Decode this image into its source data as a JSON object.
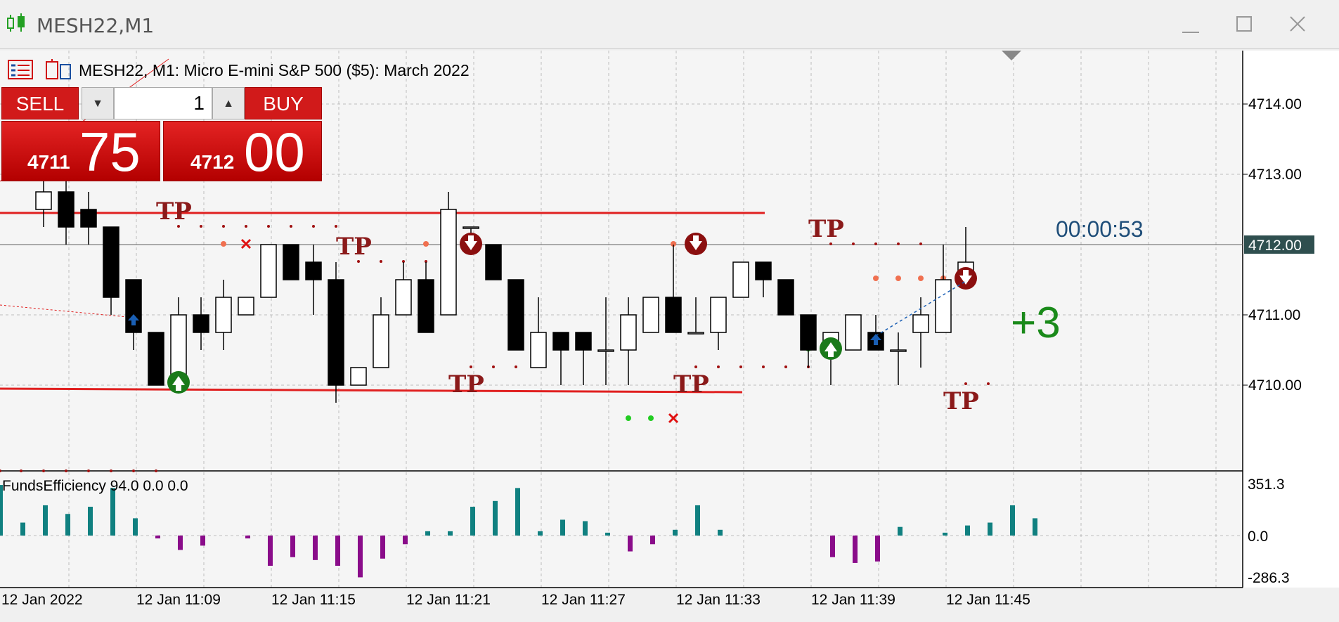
{
  "window": {
    "title": "MESH22,M1",
    "minimize_label": "minimize",
    "maximize_label": "maximize",
    "close_label": "close"
  },
  "chart": {
    "header_text": "MESH22, M1:  Micro E-mini S&P 500 ($5): March 2022",
    "timer": "00:00:53",
    "position_label": "+3",
    "current_price_label": "4712.00",
    "price_ticks": [
      "4714.00",
      "4713.00",
      "4711.00",
      "4710.00"
    ],
    "time_ticks": [
      "12 Jan 2022",
      "12 Jan 11:09",
      "12 Jan 11:15",
      "12 Jan 11:21",
      "12 Jan 11:27",
      "12 Jan 11:33",
      "12 Jan 11:39",
      "12 Jan 11:45"
    ],
    "tp_label": "TP",
    "colors": {
      "bull_fill": "#ffffff",
      "bear_fill": "#000000",
      "level_line": "#e02020",
      "tp_text": "#8b1a1a",
      "position_green": "#1a8a1a",
      "timer_blue": "#1f4e79",
      "hist_pos": "#108080",
      "hist_neg": "#8a0c8a"
    }
  },
  "indicator": {
    "label": "FundsEfficiency 94.0 0.0 0.0",
    "scale_top": "351.3",
    "scale_mid": "0.0",
    "scale_bottom": "-286.3"
  },
  "trade_panel": {
    "sell_label": "SELL",
    "buy_label": "BUY",
    "quantity": "1",
    "bid_small": "4711",
    "bid_big": "75",
    "ask_small": "4712",
    "ask_big": "00"
  },
  "chart_data": {
    "type": "candlestick",
    "candles": [
      {
        "o": 4712.5,
        "h": 4713.0,
        "l": 4712.25,
        "c": 4712.75
      },
      {
        "o": 4712.75,
        "h": 4713.0,
        "l": 4712.0,
        "c": 4712.25
      },
      {
        "o": 4712.5,
        "h": 4712.75,
        "l": 4712.0,
        "c": 4712.25
      },
      {
        "o": 4712.25,
        "h": 4712.25,
        "l": 4711.0,
        "c": 4711.25
      },
      {
        "o": 4711.5,
        "h": 4711.5,
        "l": 4710.5,
        "c": 4710.75
      },
      {
        "o": 4710.75,
        "h": 4710.75,
        "l": 4710.0,
        "c": 4710.0
      },
      {
        "o": 4710.0,
        "h": 4711.25,
        "l": 4710.0,
        "c": 4711.0
      },
      {
        "o": 4711.0,
        "h": 4711.25,
        "l": 4710.5,
        "c": 4710.75
      },
      {
        "o": 4710.75,
        "h": 4711.5,
        "l": 4710.5,
        "c": 4711.25
      },
      {
        "o": 4711.0,
        "h": 4711.25,
        "l": 4711.0,
        "c": 4711.25
      },
      {
        "o": 4711.25,
        "h": 4712.0,
        "l": 4711.25,
        "c": 4712.0
      },
      {
        "o": 4712.0,
        "h": 4712.0,
        "l": 4711.5,
        "c": 4711.5
      },
      {
        "o": 4711.75,
        "h": 4712.0,
        "l": 4711.0,
        "c": 4711.5
      },
      {
        "o": 4711.5,
        "h": 4711.75,
        "l": 4709.75,
        "c": 4710.0
      },
      {
        "o": 4710.0,
        "h": 4710.25,
        "l": 4710.0,
        "c": 4710.25
      },
      {
        "o": 4710.25,
        "h": 4711.25,
        "l": 4710.25,
        "c": 4711.0
      },
      {
        "o": 4711.0,
        "h": 4711.75,
        "l": 4711.0,
        "c": 4711.5
      },
      {
        "o": 4711.5,
        "h": 4711.75,
        "l": 4710.75,
        "c": 4710.75
      },
      {
        "o": 4711.0,
        "h": 4712.75,
        "l": 4711.0,
        "c": 4712.5
      },
      {
        "o": 4712.25,
        "h": 4712.25,
        "l": 4712.0,
        "c": 4712.25
      },
      {
        "o": 4712.0,
        "h": 4712.0,
        "l": 4711.5,
        "c": 4711.5
      },
      {
        "o": 4711.5,
        "h": 4711.5,
        "l": 4710.5,
        "c": 4710.5
      },
      {
        "o": 4710.25,
        "h": 4711.25,
        "l": 4710.25,
        "c": 4710.75
      },
      {
        "o": 4710.75,
        "h": 4710.75,
        "l": 4710.0,
        "c": 4710.5
      },
      {
        "o": 4710.75,
        "h": 4710.75,
        "l": 4710.0,
        "c": 4710.5
      },
      {
        "o": 4710.5,
        "h": 4711.25,
        "l": 4710.0,
        "c": 4710.5
      },
      {
        "o": 4710.5,
        "h": 4711.25,
        "l": 4710.0,
        "c": 4711.0
      },
      {
        "o": 4710.75,
        "h": 4711.25,
        "l": 4710.75,
        "c": 4711.25
      },
      {
        "o": 4711.25,
        "h": 4712.0,
        "l": 4710.75,
        "c": 4710.75
      },
      {
        "o": 4710.75,
        "h": 4711.25,
        "l": 4710.75,
        "c": 4710.75
      },
      {
        "o": 4710.75,
        "h": 4711.25,
        "l": 4710.5,
        "c": 4711.25
      },
      {
        "o": 4711.25,
        "h": 4711.75,
        "l": 4711.25,
        "c": 4711.75
      },
      {
        "o": 4711.75,
        "h": 4711.75,
        "l": 4711.25,
        "c": 4711.5
      },
      {
        "o": 4711.5,
        "h": 4711.5,
        "l": 4711.0,
        "c": 4711.0
      },
      {
        "o": 4711.0,
        "h": 4711.0,
        "l": 4710.25,
        "c": 4710.5
      },
      {
        "o": 4710.5,
        "h": 4710.75,
        "l": 4710.0,
        "c": 4710.75
      },
      {
        "o": 4710.5,
        "h": 4711.0,
        "l": 4710.5,
        "c": 4711.0
      },
      {
        "o": 4710.75,
        "h": 4711.0,
        "l": 4710.5,
        "c": 4710.5
      },
      {
        "o": 4710.5,
        "h": 4710.75,
        "l": 4710.0,
        "c": 4710.5
      },
      {
        "o": 4710.75,
        "h": 4711.25,
        "l": 4710.25,
        "c": 4711.0
      },
      {
        "o": 4710.75,
        "h": 4712.0,
        "l": 4710.75,
        "c": 4711.5
      },
      {
        "o": 4711.5,
        "h": 4712.25,
        "l": 4711.5,
        "c": 4711.75
      }
    ],
    "hist": [
      351,
      90,
      210,
      150,
      200,
      330,
      120,
      -20,
      -100,
      -70,
      0,
      -20,
      -210,
      -150,
      -170,
      -210,
      -290,
      -160,
      -60,
      30,
      30,
      200,
      240,
      330,
      30,
      110,
      100,
      20,
      -110,
      -60,
      40,
      210,
      40,
      0,
      0,
      0,
      0,
      -150,
      -190,
      -180,
      60,
      0,
      20,
      70,
      90,
      210,
      120
    ],
    "level_top": [
      4712.45,
      4712.45
    ],
    "level_bottom": [
      4709.95,
      4709.9
    ],
    "ylim": [
      4708.9,
      4715.0
    ]
  }
}
